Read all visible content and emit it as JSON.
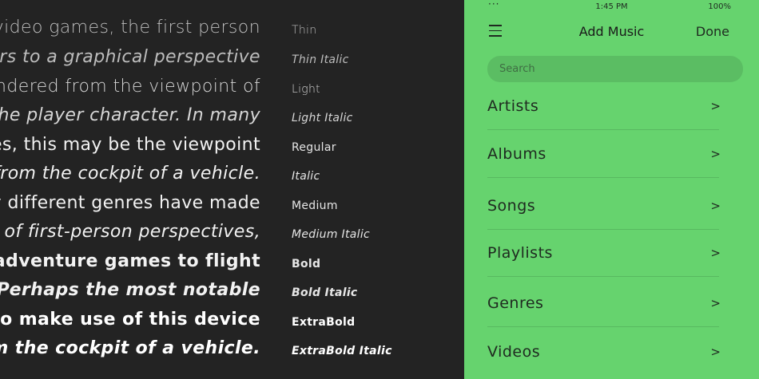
{
  "specimen": {
    "sample_lines": [
      "video games, the first person",
      "ers to a graphical perspective",
      "endered from the viewpoint of",
      "the player character. In many",
      "es, this may be the viewpoint",
      "from the cockpit of a vehicle.",
      "y different genres have made",
      "e of first-person perspectives,",
      "om adventure games to flight",
      "rs. Perhaps the most notable",
      "re to make use of this device",
      "from the cockpit of a vehicle."
    ],
    "weights": [
      "Thin",
      "Thin Italic",
      "Light",
      "Light Italic",
      "Regular",
      "Italic",
      "Medium",
      "Medium Italic",
      "Bold",
      "Bold Italic",
      "ExtraBold",
      "ExtraBold Italic"
    ]
  },
  "phone": {
    "status_dots": "···",
    "time": "1:45 PM",
    "battery": "100%",
    "title": "Add Music",
    "done_label": "Done",
    "search_placeholder": "Search",
    "menu_icon": "hamburger-icon",
    "rows": [
      {
        "label": "Artists",
        "chevron": ">"
      },
      {
        "label": "Albums",
        "chevron": ">"
      },
      {
        "label": "Songs",
        "chevron": ">"
      },
      {
        "label": "Playlists",
        "chevron": ">"
      },
      {
        "label": "Genres",
        "chevron": ">"
      },
      {
        "label": "Videos",
        "chevron": ">"
      }
    ],
    "colors": {
      "background": "#66d36e",
      "search_field": "#5bbd63",
      "divider": "#58b960"
    }
  }
}
